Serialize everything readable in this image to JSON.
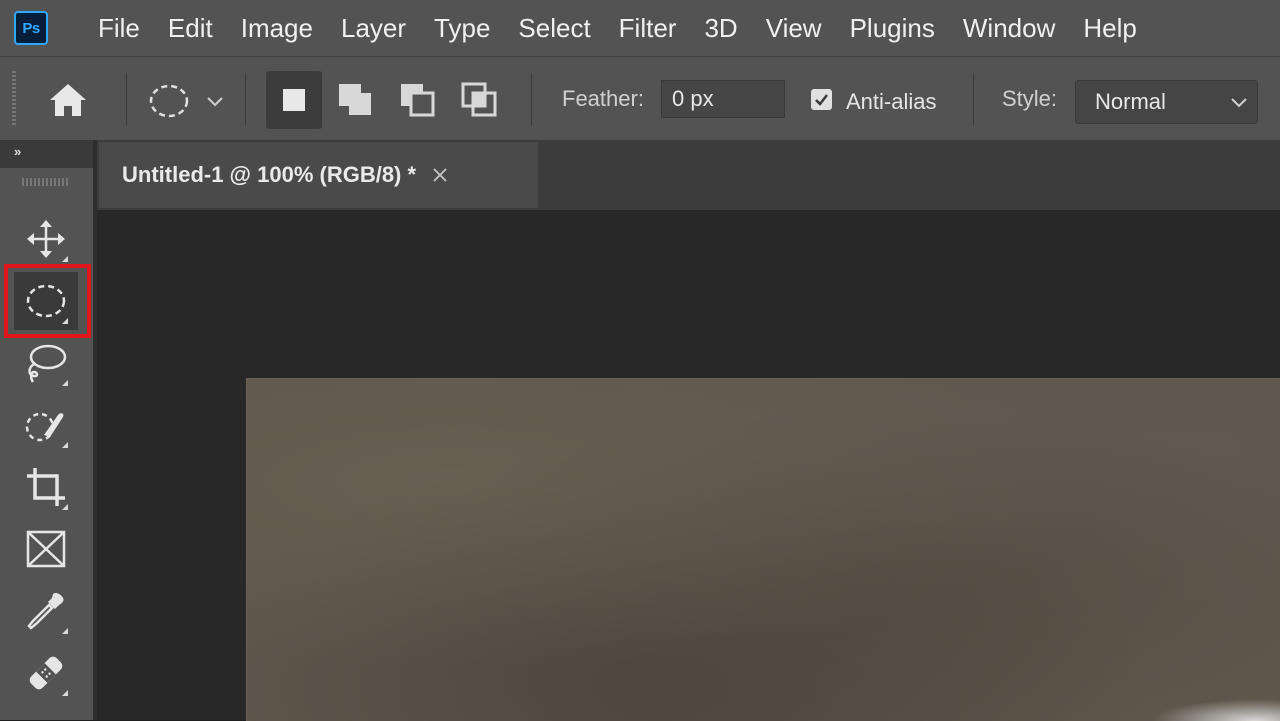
{
  "app": {
    "logo_text": "Ps"
  },
  "menu": [
    "File",
    "Edit",
    "Image",
    "Layer",
    "Type",
    "Select",
    "Filter",
    "3D",
    "View",
    "Plugins",
    "Window",
    "Help"
  ],
  "options": {
    "feather_label": "Feather:",
    "feather_value": "0 px",
    "antialias_label": "Anti-alias",
    "antialias_checked": true,
    "style_label": "Style:",
    "style_value": "Normal",
    "selection_modes": [
      "new-selection",
      "add-to-selection",
      "subtract-from-selection",
      "intersect-with-selection"
    ],
    "active_selection_mode": "new-selection"
  },
  "toolbar": {
    "collapse_label": "»",
    "tools": [
      {
        "name": "move-tool",
        "icon": "move-icon"
      },
      {
        "name": "rectangular-marquee-tool",
        "icon": "elliptical-marquee-icon",
        "active": true,
        "highlighted": true
      },
      {
        "name": "lasso-tool",
        "icon": "lasso-icon"
      },
      {
        "name": "quick-selection-tool",
        "icon": "quick-selection-icon"
      },
      {
        "name": "crop-tool",
        "icon": "crop-icon"
      },
      {
        "name": "frame-tool",
        "icon": "frame-icon"
      },
      {
        "name": "eyedropper-tool",
        "icon": "eyedropper-icon"
      },
      {
        "name": "healing-brush-tool",
        "icon": "bandage-icon"
      }
    ]
  },
  "document": {
    "tab_title": "Untitled-1 @ 100% (RGB/8) *"
  },
  "colors": {
    "highlight": "#e0161b",
    "panel": "#535353",
    "canvas_bg": "#282828"
  }
}
